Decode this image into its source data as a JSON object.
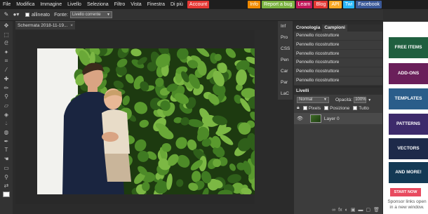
{
  "menu": [
    "File",
    "Modifica",
    "Immagine",
    "Livello",
    "Seleziona",
    "Filtro",
    "Vista",
    "Finestra",
    "Di più",
    "Account"
  ],
  "badges": [
    {
      "label": "Info",
      "color": "#f08a00"
    },
    {
      "label": "Report a bug",
      "color": "#7cb342"
    },
    {
      "label": "Learn",
      "color": "#c2185b"
    },
    {
      "label": "Blog",
      "color": "#e53935"
    },
    {
      "label": "API",
      "color": "#f9a825"
    },
    {
      "label": "Twi",
      "color": "#29b6f6"
    },
    {
      "label": "Facebook",
      "color": "#3b5998"
    }
  ],
  "account_color": "#e53935",
  "toolbar": {
    "aligned_label": "allineato",
    "source_label": "Fonte:",
    "source_value": "Livello corrente"
  },
  "document": {
    "tab_title": "Schermata 2018-11-19...",
    "close": "×"
  },
  "mini_panel": [
    "Inf",
    "Pro",
    "CSS",
    "Pen",
    "Car",
    "Par",
    "LaC"
  ],
  "history": {
    "tabs": [
      "Cronologia",
      "Campioni"
    ],
    "items": [
      "Pennello ricostruttore",
      "Pennello ricostruttore",
      "Pennello ricostruttore",
      "Pennello ricostruttore",
      "Pennello ricostruttore",
      "Pennello ricostruttore"
    ]
  },
  "layers": {
    "title": "Livelli",
    "blend_mode": "Normal",
    "opacity_label": "Opacità:",
    "opacity_value": "100%",
    "lock_options": [
      "Pixels",
      "Posizione",
      "Tutto"
    ],
    "layer_name": "Layer 0"
  },
  "ads": {
    "tiles": [
      {
        "label": "FREE ITEMS",
        "color": "#1f5f3f"
      },
      {
        "label": "ADD-ONS",
        "color": "#6a1f5a"
      },
      {
        "label": "TEMPLATES",
        "color": "#2a5d8a"
      },
      {
        "label": "PATTERNS",
        "color": "#3d2a6b"
      },
      {
        "label": "VECTORS",
        "color": "#1e2a4a"
      },
      {
        "label": "AND MORE!",
        "color": "#143a55"
      }
    ],
    "cta": "START NOW",
    "sponsor": "Sponsor links open in a new window."
  },
  "tools": [
    "move-tool-icon",
    "marquee-tool-icon",
    "lasso-tool-icon",
    "wand-tool-icon",
    "crop-tool-icon",
    "eyedropper-tool-icon",
    "heal-tool-icon",
    "brush-tool-icon",
    "clone-tool-icon",
    "eraser-tool-icon",
    "bucket-tool-icon",
    "blur-tool-icon",
    "sponge-tool-icon",
    "pen-tool-icon",
    "text-tool-icon",
    "hand-tool-icon",
    "shape-tool-icon",
    "zoom-tool-icon",
    "swap-colors-icon",
    "color-swatch-icon"
  ]
}
